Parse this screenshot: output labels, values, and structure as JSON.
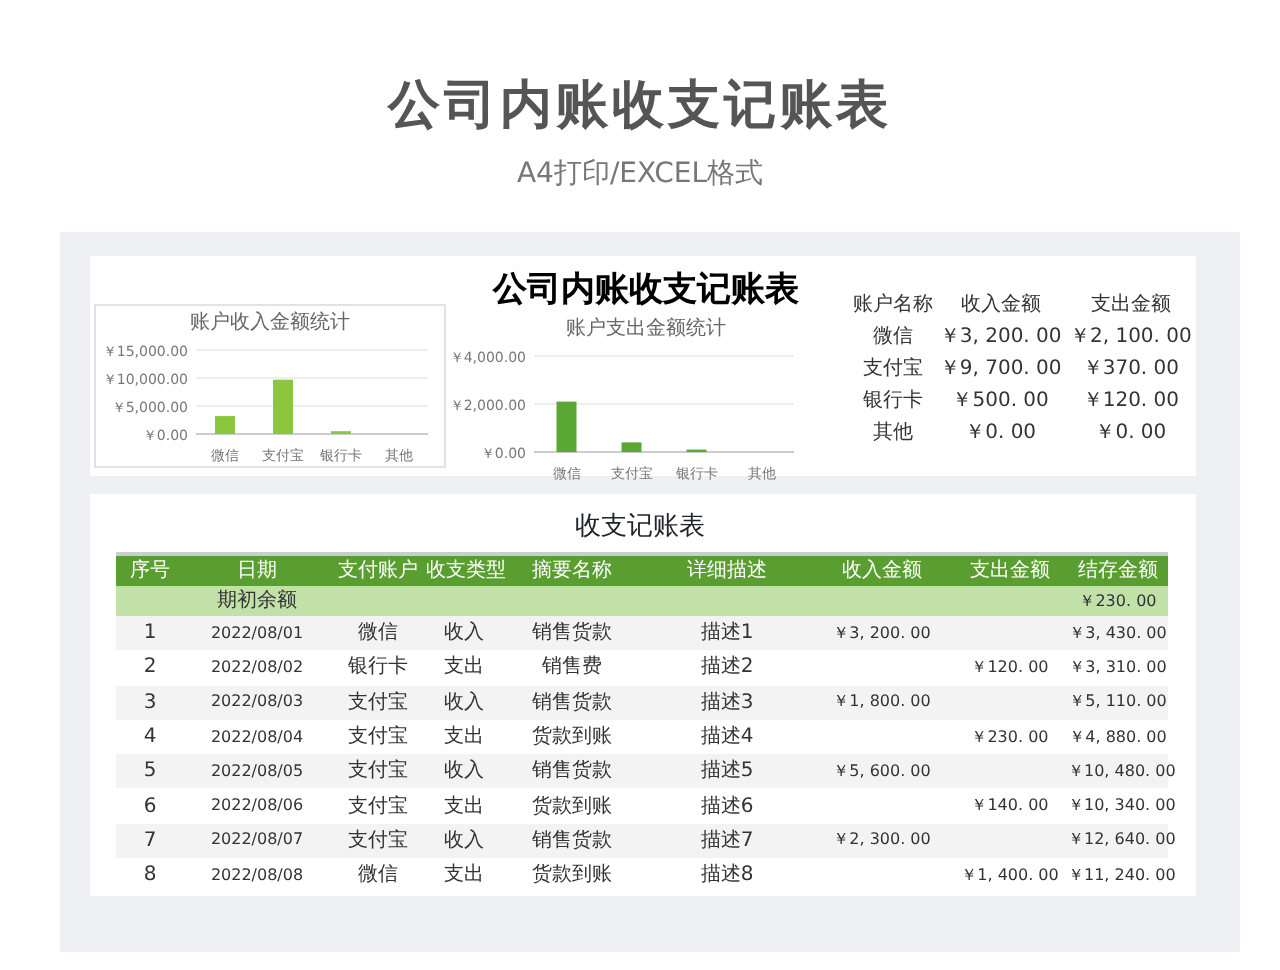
{
  "heading": "公司内账收支记账表",
  "subheading": "A4打印/EXCEL格式",
  "dashboard": {
    "title": "公司内账收支记账表",
    "income_chart": {
      "chart_data": {
        "type": "bar",
        "title": "账户收入金额统计",
        "categories": [
          "微信",
          "支付宝",
          "银行卡",
          "其他"
        ],
        "ylim": [
          0,
          15000
        ],
        "yticks": [
          {
            "value": 0,
            "label": "￥0.00"
          },
          {
            "value": 5000,
            "label": "￥5,000.00"
          },
          {
            "value": 10000,
            "label": "￥10,000.00"
          },
          {
            "value": 15000,
            "label": "￥15,000.00"
          }
        ],
        "series": [
          {
            "color": "#8cc63e",
            "values": [
              3200,
              9700,
              500,
              0
            ]
          }
        ]
      }
    },
    "expense_chart": {
      "chart_data": {
        "type": "bar",
        "title": "账户支出金额统计",
        "categories": [
          "微信",
          "支付宝",
          "银行卡",
          "其他"
        ],
        "ylim": [
          0,
          4000
        ],
        "yticks": [
          {
            "value": 0,
            "label": "￥0.00"
          },
          {
            "value": 2000,
            "label": "￥2,000.00"
          },
          {
            "value": 4000,
            "label": "￥4,000.00"
          }
        ],
        "series": [
          {
            "color": "#5aa733",
            "values": [
              2100,
              400,
              100,
              0
            ]
          }
        ]
      }
    },
    "summary": {
      "columns": [
        "账户名称",
        "收入金额",
        "支出金额"
      ],
      "rows": [
        [
          "微信",
          "￥3, 200. 00",
          "￥2, 100. 00"
        ],
        [
          "支付宝",
          "￥9, 700. 00",
          "￥370. 00"
        ],
        [
          "银行卡",
          "￥500. 00",
          "￥120. 00"
        ],
        [
          "其他",
          "￥0. 00",
          "￥0. 00"
        ]
      ]
    }
  },
  "ledger": {
    "title": "收支记账表",
    "columns": [
      "序号",
      "日期",
      "支付账户",
      "收支类型",
      "摘要名称",
      "详细描述",
      "收入金额",
      "支出金额",
      "结存金额"
    ],
    "opening": {
      "label": "期初余额",
      "balance": "￥230. 00"
    },
    "rows": [
      [
        "1",
        "2022/08/01",
        "微信",
        "收入",
        "销售货款",
        "描述1",
        "￥3, 200. 00",
        "",
        "￥3, 430. 00"
      ],
      [
        "2",
        "2022/08/02",
        "银行卡",
        "支出",
        "销售费",
        "描述2",
        "",
        "￥120. 00",
        "￥3, 310. 00"
      ],
      [
        "3",
        "2022/08/03",
        "支付宝",
        "收入",
        "销售货款",
        "描述3",
        "￥1, 800. 00",
        "",
        "￥5, 110. 00"
      ],
      [
        "4",
        "2022/08/04",
        "支付宝",
        "支出",
        "货款到账",
        "描述4",
        "",
        "￥230. 00",
        "￥4, 880. 00"
      ],
      [
        "5",
        "2022/08/05",
        "支付宝",
        "收入",
        "销售货款",
        "描述5",
        "￥5, 600. 00",
        "",
        "￥10, 480. 00"
      ],
      [
        "6",
        "2022/08/06",
        "支付宝",
        "支出",
        "货款到账",
        "描述6",
        "",
        "￥140. 00",
        "￥10, 340. 00"
      ],
      [
        "7",
        "2022/08/07",
        "支付宝",
        "收入",
        "销售货款",
        "描述7",
        "￥2, 300. 00",
        "",
        "￥12, 640. 00"
      ],
      [
        "8",
        "2022/08/08",
        "微信",
        "支出",
        "货款到账",
        "描述8",
        "",
        "￥1, 400. 00",
        "￥11, 240. 00"
      ]
    ]
  }
}
